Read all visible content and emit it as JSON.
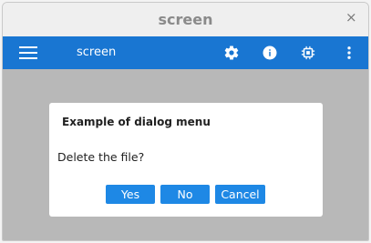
{
  "window": {
    "title": "screen",
    "close_glyph": "×"
  },
  "appbar": {
    "title": "screen",
    "actions": [
      {
        "icon": "settings-icon"
      },
      {
        "icon": "info-icon"
      },
      {
        "icon": "chip-icon"
      },
      {
        "icon": "more-vert-icon"
      }
    ],
    "color": "#1976d2"
  },
  "dialog": {
    "title": "Example of dialog menu",
    "message": "Delete the file?",
    "buttons": {
      "yes": "Yes",
      "no": "No",
      "cancel": "Cancel"
    },
    "button_color": "#1e88e5"
  },
  "overlay_color": "#b8b8b8"
}
